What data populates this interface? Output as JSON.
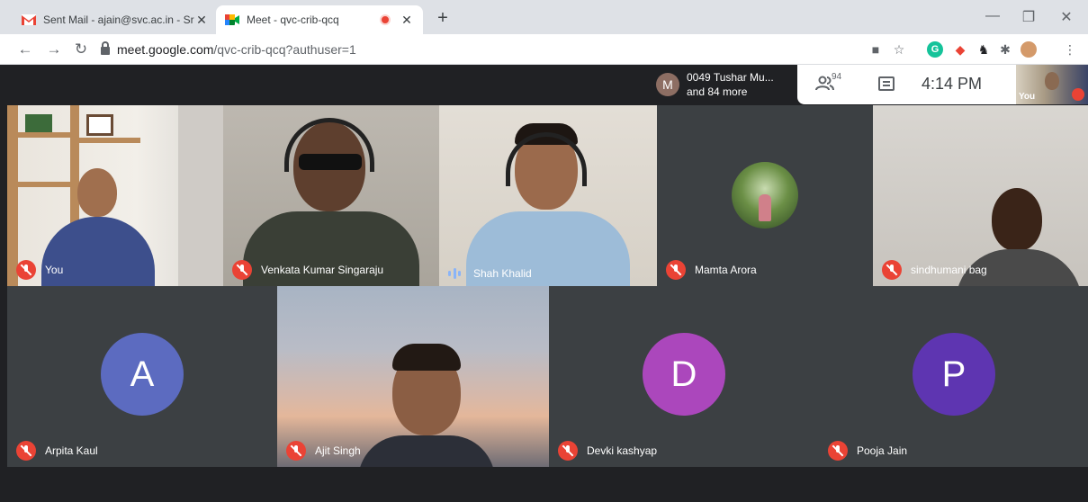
{
  "browser": {
    "tabs": [
      {
        "title": "Sent Mail - ajain@svc.ac.in - Sri V",
        "active": false,
        "favicon": "gmail-icon"
      },
      {
        "title": "Meet - qvc-crib-qcq",
        "active": true,
        "favicon": "meet-icon",
        "recording": true
      }
    ],
    "new_tab_label": "+",
    "url_host": "meet.google.com",
    "url_path": "/qvc-crib-qcq?authuser=1"
  },
  "meeting": {
    "presenter_avatar_letter": "M",
    "presenter_line1": "0049 Tushar Mu...",
    "presenter_line2": "and 84 more",
    "participant_count": "94",
    "time": "4:14 PM",
    "self_label": "You"
  },
  "participants": [
    {
      "name": "You",
      "muted": true
    },
    {
      "name": "Venkata Kumar Singaraju",
      "muted": true
    },
    {
      "name": "Shah Khalid",
      "muted": false,
      "speaking": true
    },
    {
      "name": "Mamta Arora",
      "muted": true
    },
    {
      "name": "sindhumani bag",
      "muted": true
    },
    {
      "name": "Arpita Kaul",
      "muted": true,
      "avatar_letter": "A",
      "avatar_color": "#5c6bc0"
    },
    {
      "name": "Ajit Singh",
      "muted": true
    },
    {
      "name": "Devki kashyap",
      "muted": true,
      "avatar_letter": "D",
      "avatar_color": "#ab47bc"
    },
    {
      "name": "Pooja Jain",
      "muted": true,
      "avatar_letter": "P",
      "avatar_color": "#5e35b1"
    }
  ],
  "colors": {
    "meet_background": "#202124",
    "mute_red": "#ea4335",
    "speaking_blue": "#8ab4f8"
  }
}
